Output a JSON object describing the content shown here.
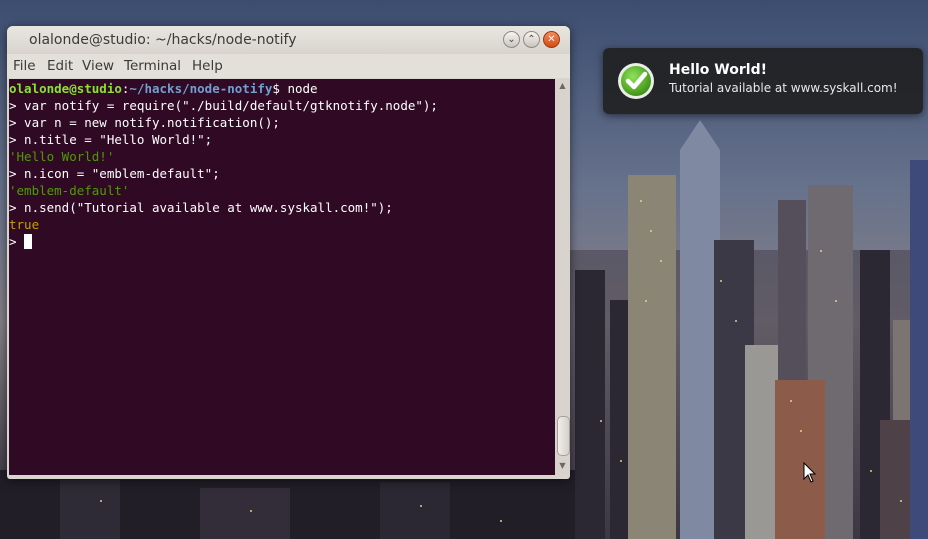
{
  "window": {
    "title": "olalonde@studio: ~/hacks/node-notify",
    "buttons": {
      "minimize": "⌄",
      "maximize": "⌃",
      "close": "✕"
    }
  },
  "menu": [
    "File",
    "Edit",
    "View",
    "Terminal",
    "Help"
  ],
  "terminal": {
    "prompt_user": "olalonde@studio",
    "prompt_sep": ":",
    "prompt_path": "~/hacks/node-notify",
    "prompt_end": "$ node",
    "lines": [
      {
        "kind": "cmd",
        "text": "> var notify = require(\"./build/default/gtknotify.node\");"
      },
      {
        "kind": "cmd",
        "text": "> var n = new notify.notification();"
      },
      {
        "kind": "cmd",
        "text": "> n.title = \"Hello World!\";"
      },
      {
        "kind": "str",
        "text": "'Hello World!'"
      },
      {
        "kind": "cmd",
        "text": "> n.icon = \"emblem-default\";"
      },
      {
        "kind": "str",
        "text": "'emblem-default'"
      },
      {
        "kind": "cmd",
        "text": "> n.send(\"Tutorial available at www.syskall.com!\");"
      },
      {
        "kind": "bool",
        "text": "true"
      }
    ],
    "input_prompt": "> "
  },
  "notification": {
    "icon": "check-icon",
    "title": "Hello World!",
    "body": "Tutorial available at www.syskall.com!"
  },
  "colors": {
    "terminal_bg": "#300a24",
    "prompt_user": "#8ae234",
    "prompt_path": "#729fcf",
    "string": "#4e9a06",
    "boolean": "#c4a000"
  }
}
